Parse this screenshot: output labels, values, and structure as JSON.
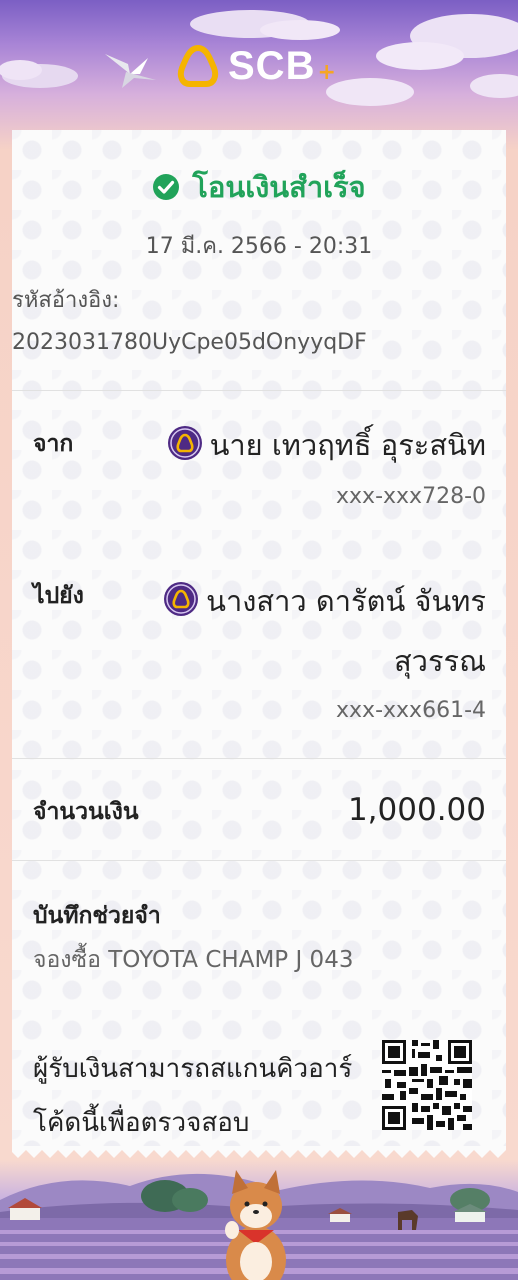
{
  "header": {
    "brand": "SCB",
    "brand_plus": "+"
  },
  "receipt": {
    "status": "โอนเงินสำเร็จ",
    "datetime": "17 มี.ค. 2566 - 20:31",
    "ref_label": "รหัสอ้างอิง:",
    "ref_value": "2023031780UyCpe05dOnyyqDF",
    "from": {
      "label": "จาก",
      "name": "นาย เทวฤทธิ์ อุระสนิท",
      "account": "xxx-xxx728-0"
    },
    "to": {
      "label": "ไปยัง",
      "name_line1": "นางสาว ดารัตน์ จันทร",
      "name_line2": "สุวรรณ",
      "account": "xxx-xxx661-4"
    },
    "amount_label": "จำนวนเงิน",
    "amount": "1,000.00",
    "memo_label": "บันทึกช่วยจำ",
    "memo": "จองซื้อ TOYOTA CHAMP J 043",
    "qr_note": "ผู้รับเงินสามารถสแกนคิวอาร์โค้ดนี้เพื่อตรวจสอบ"
  },
  "icons": {
    "status": "check-circle-icon",
    "bank": "scb-bank-icon",
    "qr": "qr-code-icon"
  },
  "colors": {
    "success": "#21a35a",
    "brand_purple": "#4e2a84",
    "brand_gold": "#f5a623"
  }
}
